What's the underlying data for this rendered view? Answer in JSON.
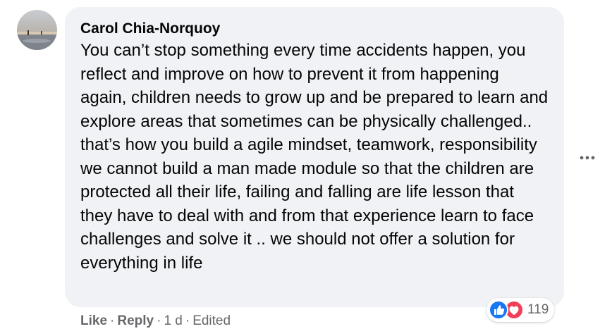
{
  "comment": {
    "author": "Carol Chia-Norquoy",
    "text": "You can’t stop something every time accidents happen, you reflect and improve on how to prevent it from happening again, children needs to grow up and be prepared to learn and explore areas that sometimes can be physically challenged.. that’s how you build a agile mindset, teamwork, responsibility we cannot build a man made module so that the children are protected all their life, failing and falling are life lesson that they have to deal with and from that experience learn to face challenges and solve it .. we should not offer a solution for everything in life",
    "reaction_count": "119",
    "reaction_types": [
      "like-icon",
      "love-icon"
    ]
  },
  "actions": {
    "like": "Like",
    "reply": "Reply",
    "separator": "·",
    "time": "1 d",
    "edited": "Edited"
  },
  "colors": {
    "bubble": "#f0f2f5",
    "text": "#050505",
    "secondary_text": "#65676b",
    "like_blue": "#1877f2",
    "love_red": "#f33e58"
  }
}
